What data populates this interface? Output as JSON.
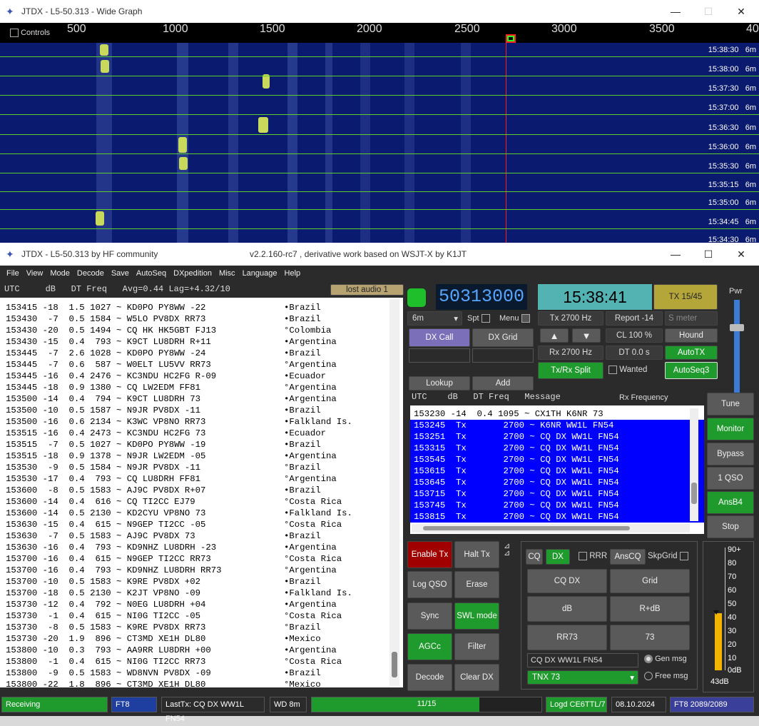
{
  "wide": {
    "title": "JTDX - L5-50.313 - Wide Graph",
    "controls": "Controls",
    "ticks": [
      "500",
      "1000",
      "1500",
      "2000",
      "2500",
      "3000",
      "3500",
      "40"
    ],
    "rows": [
      {
        "t": "15:38:30",
        "b": "6m"
      },
      {
        "t": "15:38:00",
        "b": "6m"
      },
      {
        "t": "15:37:30",
        "b": "6m"
      },
      {
        "t": "15:37:00",
        "b": "6m"
      },
      {
        "t": "15:36:30",
        "b": "6m"
      },
      {
        "t": "15:36:00",
        "b": "6m"
      },
      {
        "t": "15:35:30",
        "b": "6m"
      },
      {
        "t": "15:35:15",
        "b": "6m"
      },
      {
        "t": "15:35:00",
        "b": "6m"
      },
      {
        "t": "15:34:45",
        "b": "6m"
      },
      {
        "t": "15:34:30",
        "b": "6m"
      }
    ]
  },
  "main": {
    "title": "JTDX - L5-50.313  by HF community",
    "subtitle": "v2.2.160-rc7 , derivative work based on WSJT-X by K1JT",
    "menu": [
      "File",
      "View",
      "Mode",
      "Decode",
      "Save",
      "AutoSeq",
      "DXpedition",
      "Misc",
      "Language",
      "Help"
    ],
    "header": "UTC     dB   DT Freq   Avg=0.44 Lag=+4.32/10",
    "lost_audio": "lost audio 1",
    "decodes": [
      [
        "153415 -18  1.5 1027 ~ KD0PO PY8WW -22",
        "•Brazil"
      ],
      [
        "153430  -7  0.5 1584 ~ W5LO PV8DX RR73",
        "•Brazil"
      ],
      [
        "153430 -20  0.5 1494 ~ CQ HK HK5GBT FJ13",
        "°Colombia"
      ],
      [
        "153430 -15  0.4  793 ~ K9CT LU8DRH R+11",
        "•Argentina"
      ],
      [
        "153445  -7  2.6 1028 ~ KD0PO PY8WW -24",
        "•Brazil"
      ],
      [
        "153445  -7  0.6  587 ~ W0ELT LU5VV RR73",
        "°Argentina"
      ],
      [
        "153445 -16  0.4 2476 ~ KC3NDU HC2FG R-09",
        "•Ecuador"
      ],
      [
        "153445 -18  0.9 1380 ~ CQ LW2EDM FF81",
        "°Argentina"
      ],
      [
        "153500 -14  0.4  794 ~ K9CT LU8DRH 73",
        "•Argentina"
      ],
      [
        "153500 -10  0.5 1587 ~ N9JR PV8DX -11",
        "•Brazil"
      ],
      [
        "153500 -16  0.6 2134 ~ K3WC VP8NO RR73",
        "•Falkland Is."
      ],
      [
        "153515 -16  0.4 2473 ~ KC3NDU HC2FG 73",
        "•Ecuador"
      ],
      [
        "153515  -7  0.5 1027 ~ KD0PO PY8WW -19",
        "•Brazil"
      ],
      [
        "153515 -18  0.9 1378 ~ N9JR LW2EDM -05",
        "•Argentina"
      ],
      [
        "153530  -9  0.5 1584 ~ N9JR PV8DX -11",
        "°Brazil"
      ],
      [
        "153530 -17  0.4  793 ~ CQ LU8DRH FF81",
        "°Argentina"
      ],
      [
        "153600  -8  0.5 1583 ~ AJ9C PV8DX R+07",
        "•Brazil"
      ],
      [
        "153600 -14  0.4  616 ~ CQ TI2CC EJ79",
        "°Costa Rica"
      ],
      [
        "153600 -14  0.5 2130 ~ KD2CYU VP8NO 73",
        "•Falkland Is."
      ],
      [
        "153630 -15  0.4  615 ~ N9GEP TI2CC -05",
        "°Costa Rica"
      ],
      [
        "153630  -7  0.5 1583 ~ AJ9C PV8DX 73",
        "•Brazil"
      ],
      [
        "153630 -16  0.4  793 ~ KD9NHZ LU8DRH -23",
        "•Argentina"
      ],
      [
        "153700 -16  0.4  615 ~ N9GEP TI2CC RR73",
        "°Costa Rica"
      ],
      [
        "153700 -16  0.4  793 ~ KD9NHZ LU8DRH RR73",
        "°Argentina"
      ],
      [
        "153700 -10  0.5 1583 ~ K9RE PV8DX +02",
        "•Brazil"
      ],
      [
        "153700 -18  0.5 2130 ~ K2JT VP8NO -09",
        "•Falkland Is."
      ],
      [
        "153730 -12  0.4  792 ~ N0EG LU8DRH +04",
        "•Argentina"
      ],
      [
        "153730  -1  0.4  615 ~ NI0G TI2CC -05",
        "°Costa Rica"
      ],
      [
        "153730  -8  0.5 1583 ~ K9RE PV8DX RR73",
        "°Brazil"
      ],
      [
        "153730 -20  1.9  896 ~ CT3MD XE1H DL80",
        "•Mexico"
      ],
      [
        "153800 -10  0.3  793 ~ AA9RR LU8DRH +00",
        "•Argentina"
      ],
      [
        "153800  -1  0.4  615 ~ NI0G TI2CC RR73",
        "°Costa Rica"
      ],
      [
        "153800  -9  0.5 1583 ~ WD8NVN PV8DX -09",
        "•Brazil"
      ],
      [
        "153800 -22  1.8  896 ~ CT3MD XE1H DL80",
        "°Mexico"
      ]
    ],
    "freq": "50313000",
    "clock": "15:38:41",
    "tx_period": "TX 15/45",
    "pwr": "Pwr",
    "band": "6m",
    "spt": "Spt",
    "menu_lbl": "Menu",
    "tx_hz": "Tx  2700  Hz",
    "rx_hz": "Rx  2700  Hz",
    "report": "Report -14",
    "smeter": "S meter",
    "cl": "CL  100 %",
    "hound": "Hound",
    "dt": "DT 0.0 s",
    "autotx": "AutoTX",
    "dxcall": "DX Call",
    "dxgrid": "DX Grid",
    "txrx_split": "Tx/Rx Split",
    "wanted": "Wanted",
    "autoseq3": "AutoSeq3",
    "lookup": "Lookup",
    "add": "Add",
    "rx_header": "UTC    dB   DT Freq   Message",
    "rx_freq": "Rx Frequency",
    "rx_rows": [
      "153230 -14  0.4 1095 ~ CX1TH K6NR 73",
      "153245  Tx       2700 ~ K6NR WW1L FN54",
      "153251  Tx       2700 ~ CQ DX WW1L FN54",
      "153315  Tx       2700 ~ CQ DX WW1L FN54",
      "153545  Tx       2700 ~ CQ DX WW1L FN54",
      "153615  Tx       2700 ~ CQ DX WW1L FN54",
      "153645  Tx       2700 ~ CQ DX WW1L FN54",
      "153715  Tx       2700 ~ CQ DX WW1L FN54",
      "153745  Tx       2700 ~ CQ DX WW1L FN54",
      "153815  Tx       2700 ~ CQ DX WW1L FN54"
    ],
    "right_btns": [
      "Tune",
      "Monitor",
      "Bypass",
      "1 QSO",
      "AnsB4",
      "Stop"
    ],
    "left_btns": [
      "Enable Tx",
      "Halt Tx",
      "Log QSO",
      "Erase",
      "Sync",
      "SWL mode",
      "AGCc",
      "Filter",
      "Decode",
      "Clear DX"
    ],
    "cq": "CQ",
    "dx": "DX",
    "rrr": "RRR",
    "anscq": "AnsCQ",
    "skpgrid": "SkpGrid",
    "msg_btns": [
      "CQ DX",
      "Grid",
      "dB",
      "R+dB",
      "RR73",
      "73"
    ],
    "gen_text": "CQ DX WW1L FN54",
    "gen_msg": "Gen msg",
    "free_text": "TNX 73",
    "free_msg": "Free msg",
    "meter_ticks": [
      "90+",
      "80",
      "70",
      "60",
      "50",
      "40",
      "30",
      "20",
      "10",
      "0dB"
    ],
    "meter_val": "43dB",
    "status": {
      "receiving": "Receiving",
      "mode": "FT8",
      "lasttx": "LastTx: CQ DX WW1L FN54",
      "wd": "WD 8m",
      "progress": "11/15",
      "logd": "Logd CE6TTL/7",
      "date": "08.10.2024",
      "ft8": "FT8  2089/2089"
    }
  },
  "colors": {
    "green": "#1f9a2c",
    "red": "#a00000",
    "blue": "#0000ff",
    "clock_bg": "#53b3b3",
    "freq_fg": "#55a6ff"
  }
}
